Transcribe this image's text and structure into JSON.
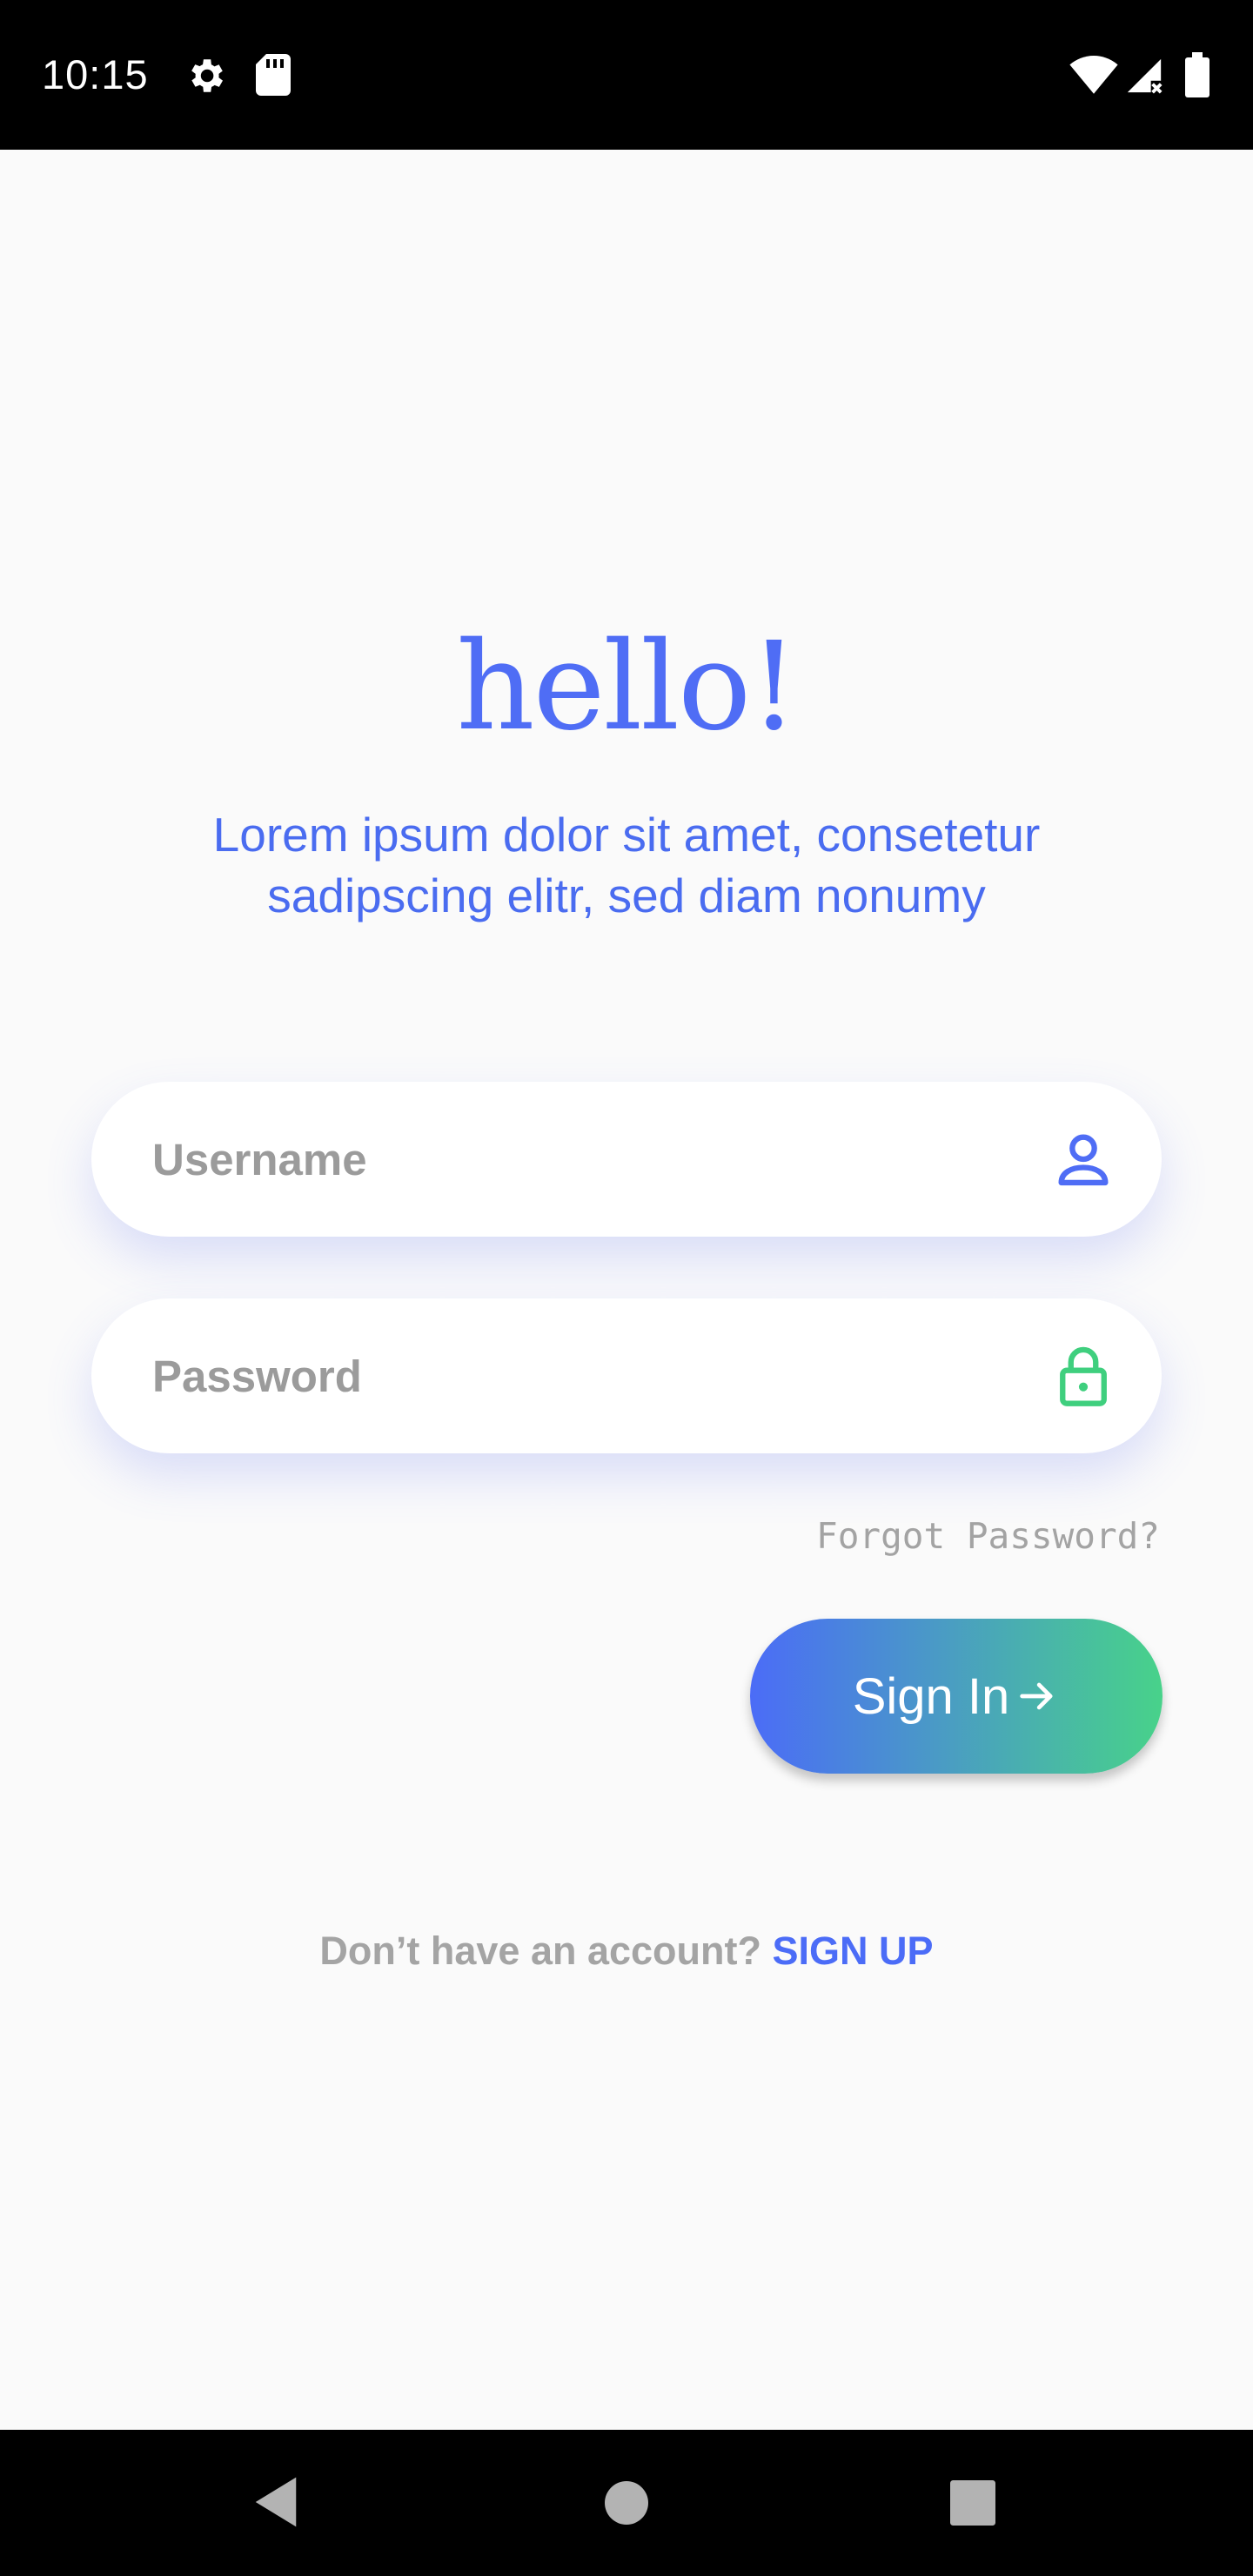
{
  "status_bar": {
    "time": "10:15",
    "icons": [
      "settings-gear-icon",
      "sd-card-icon",
      "wifi-icon",
      "cell-signal-icon",
      "battery-icon"
    ]
  },
  "header": {
    "title": "hello!",
    "subtitle": "Lorem ipsum dolor sit amet, consetetur sadipscing elitr, sed diam nonumy"
  },
  "form": {
    "username": {
      "placeholder": "Username",
      "value": "",
      "icon": "person-icon"
    },
    "password": {
      "placeholder": "Password",
      "value": "",
      "icon": "lock-icon"
    },
    "forgot_label": "Forgot Password?",
    "sign_in_label": "Sign In"
  },
  "footer": {
    "prompt": "Don’t have an account?",
    "signup_label": "SIGN UP"
  },
  "colors": {
    "accent_blue": "#4f6df5",
    "accent_green": "#48d28a",
    "background": "#fafafa"
  },
  "nav_bar": {
    "icons": [
      "back-icon",
      "home-icon",
      "recents-icon"
    ]
  }
}
